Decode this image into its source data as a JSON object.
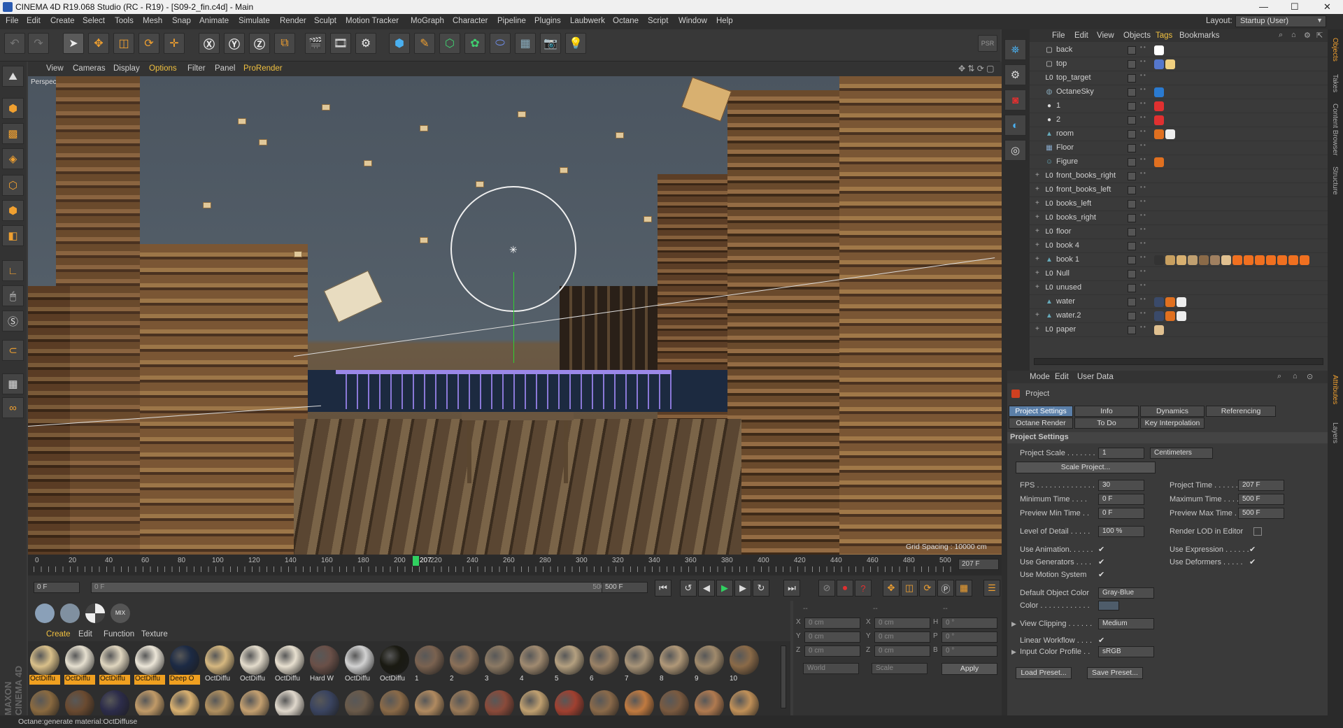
{
  "title": "CINEMA 4D R19.068 Studio (RC - R19) - [S09-2_fin.c4d] - Main",
  "window_controls": {
    "minimize": "—",
    "maximize": "☐",
    "close": "✕"
  },
  "menu": [
    "File",
    "Edit",
    "Create",
    "Select",
    "Tools",
    "Mesh",
    "Snap",
    "Animate",
    "Simulate",
    "Render",
    "Sculpt",
    "Motion Tracker",
    "MoGraph",
    "Character",
    "Pipeline",
    "Plugins",
    "Laubwerk",
    "Octane",
    "Script",
    "Window",
    "Help"
  ],
  "layout": {
    "label": "Layout:",
    "value": "Startup (User)"
  },
  "viewport": {
    "menu": [
      "View",
      "Cameras",
      "Display",
      "Options",
      "Filter",
      "Panel",
      "ProRender"
    ],
    "label": "Perspective",
    "grid_spacing": "Grid Spacing : 10000 cm"
  },
  "timeline": {
    "ticks": [
      "0",
      "20",
      "40",
      "60",
      "80",
      "100",
      "120",
      "140",
      "160",
      "180",
      "200",
      "220",
      "240",
      "260",
      "280",
      "300",
      "320",
      "340",
      "360",
      "380",
      "400",
      "420",
      "440",
      "460",
      "480",
      "500"
    ],
    "current_marker": "207",
    "current_frame": "207 F"
  },
  "transport": {
    "start": "0 F",
    "range_start": "0 F",
    "range_end": "500 F",
    "end": "500 F"
  },
  "materials": {
    "menu": [
      "Create",
      "Edit",
      "Function",
      "Texture"
    ],
    "row1": [
      {
        "label": "OctDiffu",
        "color": "#d9c08a",
        "selected": true
      },
      {
        "label": "OctDiffu",
        "color": "#e6e0d0",
        "selected": true
      },
      {
        "label": "OctDiffu",
        "color": "#e0d6bf",
        "selected": true
      },
      {
        "label": "OctDiffu",
        "color": "#ece6d8",
        "selected": true
      },
      {
        "label": "Deep O",
        "color": "#1c2a44",
        "selected": true
      },
      {
        "label": "OctDiffu",
        "color": "#d6b880",
        "selected": false
      },
      {
        "label": "OctDiffu",
        "color": "#e4dccc",
        "selected": false
      },
      {
        "label": "OctDiffu",
        "color": "#e8e0d0",
        "selected": false
      },
      {
        "label": "Hard W",
        "color": "#6a5048",
        "selected": false
      },
      {
        "label": "OctDiffu",
        "color": "#d2d2d2",
        "selected": false
      },
      {
        "label": "OctDiffu",
        "color": "#1a1a12",
        "selected": false
      },
      {
        "label": "1",
        "color": "#7a6250",
        "selected": false
      },
      {
        "label": "2",
        "color": "#8a7058",
        "selected": false
      },
      {
        "label": "3",
        "color": "#8c7a64",
        "selected": false
      },
      {
        "label": "4",
        "color": "#a08a70",
        "selected": false
      },
      {
        "label": "5",
        "color": "#b4a080",
        "selected": false
      },
      {
        "label": "6",
        "color": "#9a8266",
        "selected": false
      },
      {
        "label": "7",
        "color": "#a89478",
        "selected": false
      },
      {
        "label": "8",
        "color": "#b09878",
        "selected": false
      },
      {
        "label": "9",
        "color": "#a08a6c",
        "selected": false
      },
      {
        "label": "10",
        "color": "#8a6a48",
        "selected": false
      }
    ],
    "row2_colors": [
      "#8a6a40",
      "#6a4a30",
      "#2c2c4a",
      "#c09a68",
      "#d8b070",
      "#b09060",
      "#c4a070",
      "#e0d8cc",
      "#3a4460",
      "#6a5a4a",
      "#8a6a48",
      "#b08a60",
      "#9a7a58",
      "#8a4a3a",
      "#c0a070",
      "#a04030",
      "#8a6a4a",
      "#c07a40",
      "#7a5a40",
      "#b07a50",
      "#c09058"
    ]
  },
  "coords": {
    "header": [
      "--",
      "--",
      "--"
    ],
    "rows": [
      {
        "a": "X",
        "av": "0 cm",
        "b": "X",
        "bv": "0 cm",
        "c": "H",
        "cv": "0 °"
      },
      {
        "a": "Y",
        "av": "0 cm",
        "b": "Y",
        "bv": "0 cm",
        "c": "P",
        "cv": "0 °"
      },
      {
        "a": "Z",
        "av": "0 cm",
        "b": "Z",
        "bv": "0 cm",
        "c": "B",
        "cv": "0 °"
      }
    ],
    "mode1": "World",
    "mode2": "Scale",
    "apply": "Apply"
  },
  "status": "Octane:generate material:OctDiffuse",
  "object_manager": {
    "menu": [
      "File",
      "Edit",
      "View",
      "Objects",
      "Tags",
      "Bookmarks"
    ],
    "objects": [
      {
        "name": "back",
        "icon": "▢",
        "icolor": "#ddd",
        "expand": "",
        "tags": [
          "#ffffff"
        ]
      },
      {
        "name": "top",
        "icon": "▢",
        "icolor": "#ddd",
        "expand": "",
        "tags": [
          "#5577cc",
          "#f0d080"
        ]
      },
      {
        "name": "top_target",
        "icon": "L0",
        "icolor": "#ddd",
        "expand": "",
        "tags": []
      },
      {
        "name": "OctaneSky",
        "icon": "◍",
        "icolor": "#8ab",
        "expand": "",
        "tags": [
          "#2a7ad0"
        ]
      },
      {
        "name": "1",
        "icon": "●",
        "icolor": "#ddd",
        "expand": "",
        "tags": [
          "#e03030"
        ]
      },
      {
        "name": "2",
        "icon": "●",
        "icolor": "#ddd",
        "expand": "",
        "tags": [
          "#e03030"
        ]
      },
      {
        "name": "room",
        "icon": "▲",
        "icolor": "#6ab",
        "expand": "",
        "tags": [
          "#e07020",
          "#eeeeee"
        ]
      },
      {
        "name": "Floor",
        "icon": "▦",
        "icolor": "#8ac",
        "expand": "",
        "tags": []
      },
      {
        "name": "Figure",
        "icon": "☺",
        "icolor": "#6ab",
        "expand": "",
        "tags": [
          "#e07020"
        ]
      },
      {
        "name": "front_books_right",
        "icon": "L0",
        "icolor": "#ddd",
        "expand": "+",
        "tags": []
      },
      {
        "name": "front_books_left",
        "icon": "L0",
        "icolor": "#ddd",
        "expand": "+",
        "tags": []
      },
      {
        "name": "books_left",
        "icon": "L0",
        "icolor": "#ddd",
        "expand": "+",
        "tags": []
      },
      {
        "name": "books_right",
        "icon": "L0",
        "icolor": "#ddd",
        "expand": "+",
        "tags": []
      },
      {
        "name": "floor",
        "icon": "L0",
        "icolor": "#ddd",
        "expand": "+",
        "tags": []
      },
      {
        "name": "book 4",
        "icon": "L0",
        "icolor": "#ddd",
        "expand": "+",
        "tags": []
      },
      {
        "name": "book 1",
        "icon": "▲",
        "icolor": "#6ab",
        "expand": "+",
        "tags": [
          "#333",
          "#c8a060",
          "#d8b070",
          "#c0a070",
          "#8a6a48",
          "#a08060",
          "#e0c090",
          "#f07020",
          "#f07020",
          "#f07020",
          "#f07020",
          "#f07020",
          "#f07020",
          "#f07020"
        ]
      },
      {
        "name": "Null",
        "icon": "L0",
        "icolor": "#ddd",
        "expand": "+",
        "tags": []
      },
      {
        "name": "unused",
        "icon": "L0",
        "icolor": "#ddd",
        "expand": "+",
        "tags": []
      },
      {
        "name": "water",
        "icon": "▲",
        "icolor": "#6ab",
        "expand": "",
        "tags": [
          "#3a4a6a",
          "#e07020",
          "#eeeeee"
        ]
      },
      {
        "name": "water.2",
        "icon": "▲",
        "icolor": "#6ab",
        "expand": "+",
        "tags": [
          "#3a4a6a",
          "#e07020",
          "#eeeeee"
        ]
      },
      {
        "name": "paper",
        "icon": "L0",
        "icolor": "#ddd",
        "expand": "+",
        "tags": [
          "#e0c090"
        ]
      }
    ]
  },
  "attributes": {
    "menu": [
      "Mode",
      "Edit",
      "User Data"
    ],
    "title": "Project",
    "tabs_row1": [
      "Project Settings",
      "Info",
      "Dynamics",
      "Referencing"
    ],
    "tabs_row2": [
      "Octane Render",
      "To Do",
      "Key Interpolation"
    ],
    "section": "Project Settings",
    "project_scale_label": "Project Scale . . . . . . .",
    "project_scale": "1",
    "scale_unit": "Centimeters",
    "scale_project": "Scale Project...",
    "fps_label": "FPS . . . . . . . . . . . . . .",
    "fps": "30",
    "project_time_label": "Project Time . . . . . . .",
    "project_time": "207 F",
    "min_time_label": "Minimum Time . . . .",
    "min_time": "0 F",
    "max_time_label": "Maximum Time . . . .",
    "max_time": "500 F",
    "prev_min_label": "Preview Min Time . .",
    "prev_min": "0 F",
    "prev_max_label": "Preview Max Time . .",
    "prev_max": "500 F",
    "lod_label": "Level of Detail . . . . .",
    "lod": "100 %",
    "render_lod_label": "Render LOD in Editor",
    "use_anim": "Use Animation. . . . . .",
    "use_expr": "Use Expression . . . . . .",
    "use_gen": "Use Generators . . . .",
    "use_def": "Use Deformers . . . . .",
    "use_motion": "Use Motion System",
    "default_color_label": "Default Object Color",
    "default_color": "Gray-Blue",
    "color_label": "Color . . . . . . . . . . . .",
    "view_clip_label": "View Clipping . . . . . .",
    "view_clip": "Medium",
    "linear_label": "Linear Workflow . . . .",
    "icp_label": "Input Color Profile . .",
    "icp": "sRGB",
    "load_preset": "Load Preset...",
    "save_preset": "Save Preset..."
  },
  "side_tabs": [
    "Objects",
    "Takes",
    "Content Browser",
    "Structure",
    "Attributes",
    "Layers"
  ],
  "colors": {
    "accent": "#5b7fa8",
    "selected_material": "#f0a020",
    "viewport_bg": "#55606a"
  }
}
